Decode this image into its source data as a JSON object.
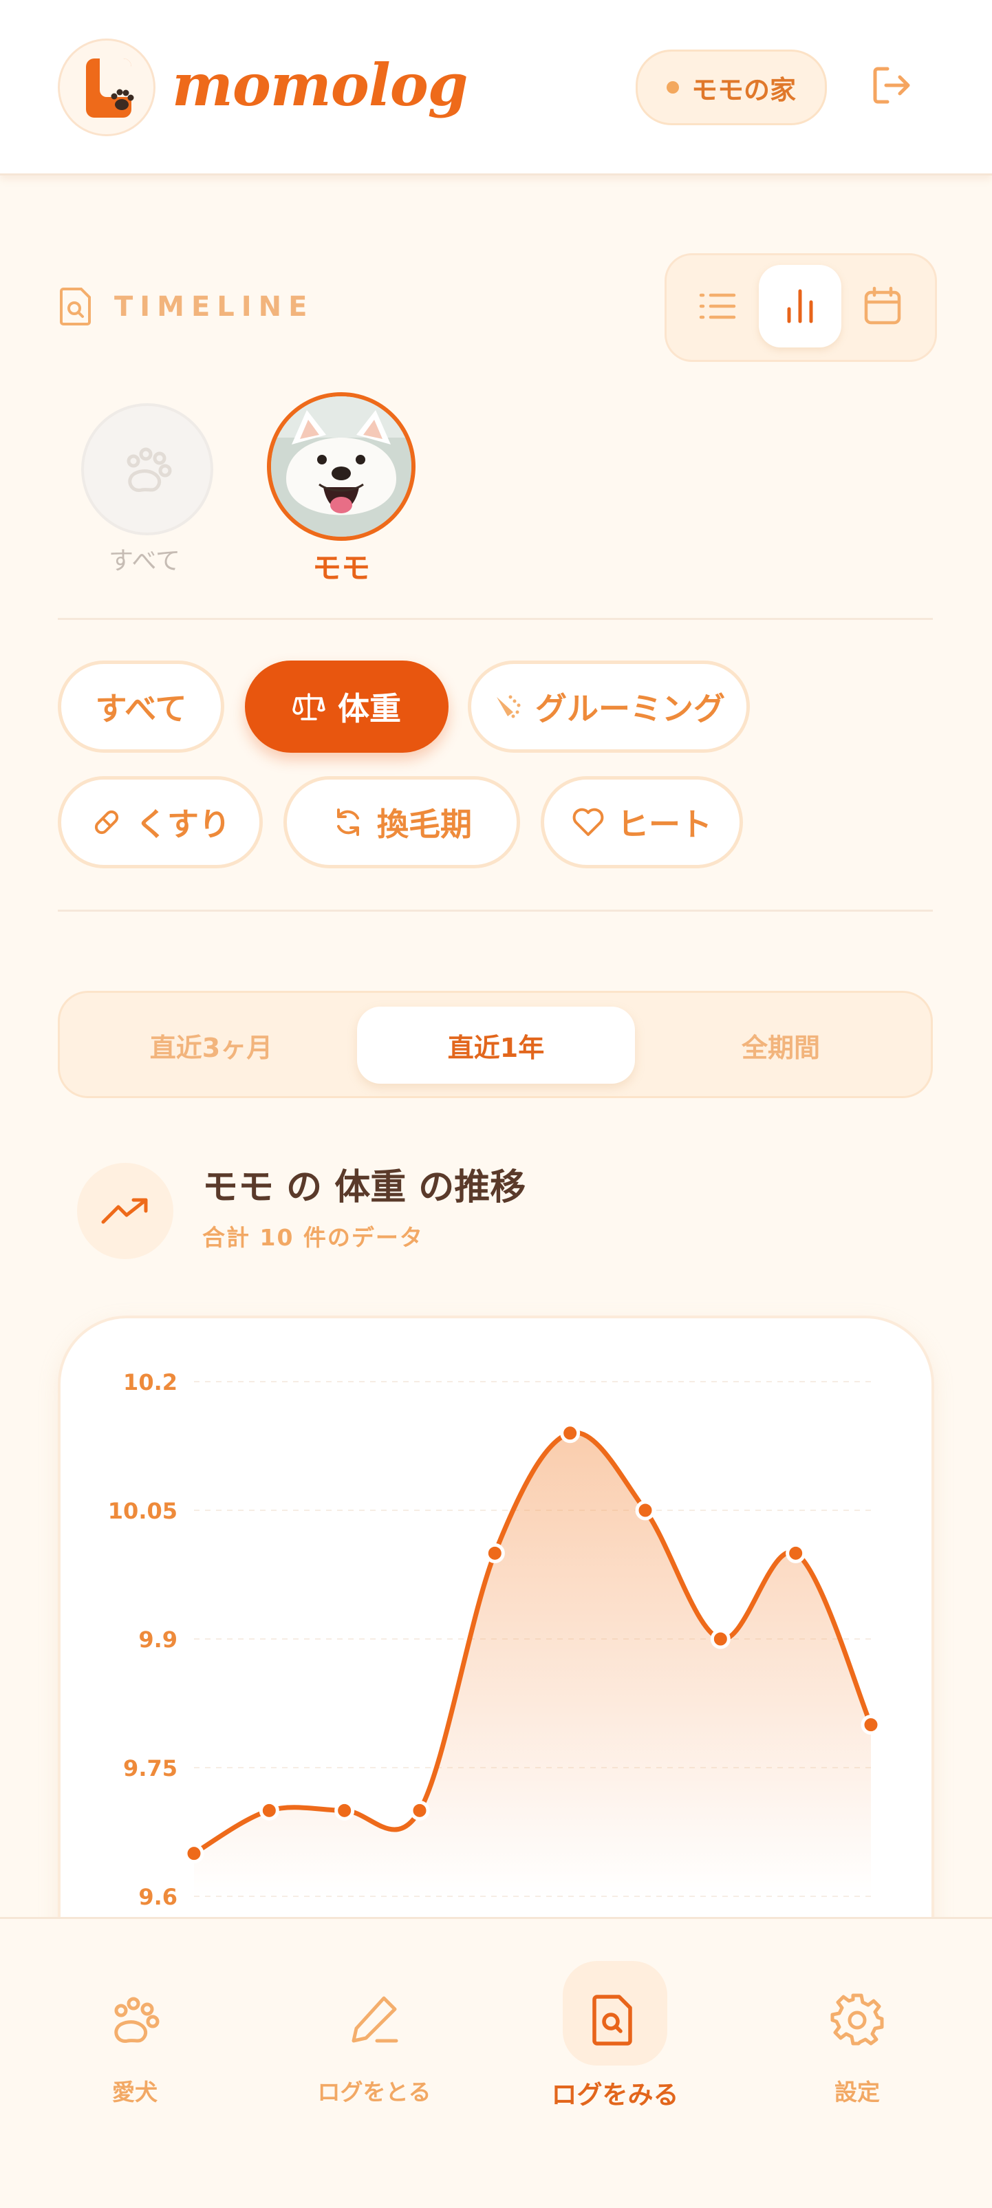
{
  "brand": {
    "name": "momolog"
  },
  "header": {
    "home_label": "モモの家",
    "logout_icon": "logout-icon"
  },
  "timeline": {
    "title": "TIMELINE"
  },
  "view_toggle": {
    "items": [
      "list",
      "chart",
      "calendar"
    ],
    "active": "chart"
  },
  "pets": [
    {
      "label": "すべて",
      "selected": false
    },
    {
      "label": "モモ",
      "selected": true
    }
  ],
  "categories": [
    {
      "label": "すべて",
      "icon": "",
      "active": false
    },
    {
      "label": "体重",
      "icon": "scale-icon",
      "active": true
    },
    {
      "label": "グルーミング",
      "icon": "shower-icon",
      "active": false
    },
    {
      "label": "くすり",
      "icon": "pill-icon",
      "active": false
    },
    {
      "label": "換毛期",
      "icon": "refresh-icon",
      "active": false
    },
    {
      "label": "ヒート",
      "icon": "heart-icon",
      "active": false
    }
  ],
  "period": {
    "options": [
      "直近3ヶ月",
      "直近1年",
      "全期間"
    ],
    "active": 1
  },
  "chart_header": {
    "title": "モモ の 体重 の推移",
    "subtitle": "合計 10 件のデータ"
  },
  "chart_data": {
    "type": "area",
    "title": "",
    "xlabel": "",
    "ylabel": "",
    "ylim": [
      9.6,
      10.2
    ],
    "yticks": [
      "10.2",
      "10.05",
      "9.9",
      "9.75",
      "9.6"
    ],
    "y": [
      9.65,
      9.7,
      9.7,
      9.7,
      10.0,
      10.14,
      10.05,
      9.9,
      10.0,
      9.8
    ],
    "grid": true,
    "colors": {
      "line": "#EE6A1A",
      "fill": "#F6A46A"
    }
  },
  "bottom_nav": [
    {
      "label": "愛犬",
      "icon": "paw-icon",
      "active": false
    },
    {
      "label": "ログをとる",
      "icon": "pencil-icon",
      "active": false
    },
    {
      "label": "ログをみる",
      "icon": "document-search-icon",
      "active": true
    },
    {
      "label": "設定",
      "icon": "gear-icon",
      "active": false
    }
  ],
  "colors": {
    "accent": "#EE6A1A",
    "background": "#FFF9F1",
    "soft": "#F2B47C"
  }
}
